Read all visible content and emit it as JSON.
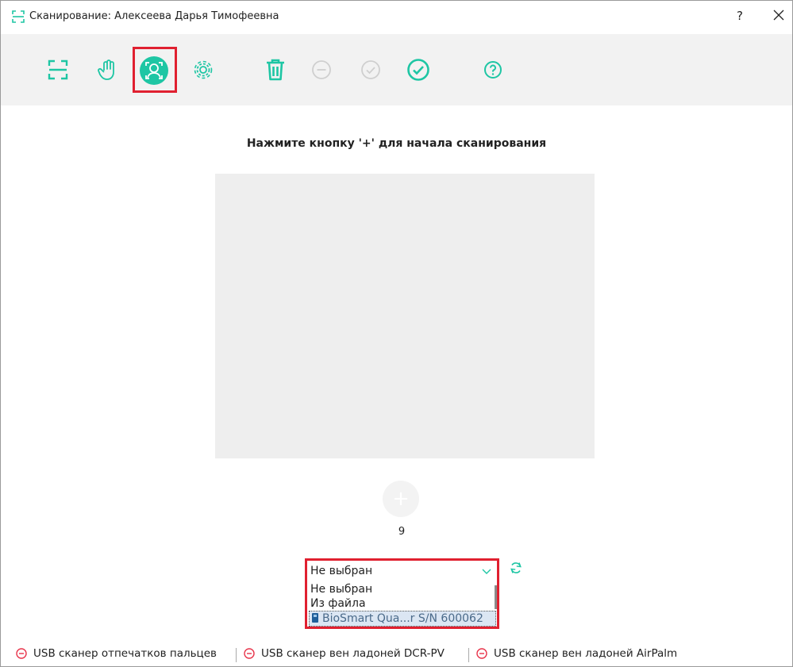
{
  "window": {
    "title": "Сканирование: Алексеева  Дарья  Тимофеевна",
    "help_label": "?",
    "accent_color": "#1ec6a4",
    "highlight_color": "#e02030"
  },
  "toolbar": {
    "buttons": [
      {
        "name": "scan-frame-icon",
        "state": "enabled"
      },
      {
        "name": "palm-icon",
        "state": "enabled"
      },
      {
        "name": "face-scan-icon",
        "state": "active"
      },
      {
        "name": "settings-icon",
        "state": "enabled"
      },
      {
        "name": "trash-icon",
        "state": "enabled"
      },
      {
        "name": "remove-circle-icon",
        "state": "disabled"
      },
      {
        "name": "check-circle-icon",
        "state": "disabled"
      },
      {
        "name": "confirm-circle-icon",
        "state": "enabled"
      },
      {
        "name": "help-circle-icon",
        "state": "enabled"
      }
    ]
  },
  "main": {
    "hint": "Нажмите кнопку '+' для начала сканирования",
    "add_label": "+",
    "count": "9"
  },
  "device_select": {
    "selected": "Не выбран",
    "options": [
      "Не выбран",
      "Из файла",
      "BioSmart Qua...r S/N 600062"
    ],
    "highlighted_option": "BioSmart Qua...r S/N 600062"
  },
  "status": {
    "items": [
      {
        "label": "USB сканер отпечатков пальцев",
        "state": "disconnected"
      },
      {
        "label": "USB сканер вен ладоней DCR-PV",
        "state": "disconnected"
      },
      {
        "label": "USB сканер вен ладоней AirPalm",
        "state": "disconnected"
      }
    ]
  }
}
